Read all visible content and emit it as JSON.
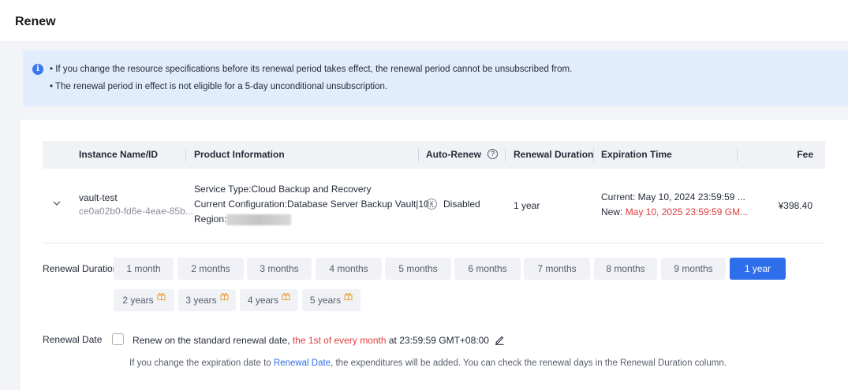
{
  "page": {
    "title": "Renew"
  },
  "notice": {
    "lines": [
      "If you change the resource specifications before its renewal period takes effect, the renewal period cannot be unsubscribed from.",
      "The renewal period in effect is not eligible for a 5-day unconditional unsubscription."
    ]
  },
  "table": {
    "headers": {
      "instance": "Instance Name/ID",
      "product": "Product Information",
      "auto_renew": "Auto-Renew",
      "duration": "Renewal Duration",
      "expiration": "Expiration Time",
      "fee": "Fee"
    },
    "row": {
      "name": "vault-test",
      "id": "ce0a02b0-fd6e-4eae-85b...",
      "service_type": "Service Type:Cloud Backup and Recovery",
      "configuration": "Current Configuration:Database Server Backup Vault|10...",
      "region_label": "Region:",
      "auto_renew": "Disabled",
      "duration": "1 year",
      "current_label": "Current: May 10, 2024 23:59:59 ...",
      "new_label": "New: ",
      "new_date": "May 10, 2025 23:59:59 GM...",
      "fee": "¥398.40"
    }
  },
  "renewal_duration": {
    "label": "Renewal Duration",
    "options": [
      "1 month",
      "2 months",
      "3 months",
      "4 months",
      "5 months",
      "6 months",
      "7 months",
      "8 months",
      "9 months",
      "1 year"
    ],
    "year_options": [
      "2 years",
      "3 years",
      "4 years",
      "5 years"
    ],
    "selected": "1 year"
  },
  "renewal_date": {
    "label": "Renewal Date",
    "checked": false,
    "text_before": "Renew on the standard renewal date, ",
    "highlight": "the 1st of every month",
    "text_after": " at 23:59:59 GMT+08:00",
    "hint_before": "If you change the expiration date to ",
    "hint_link": "Renewal Date",
    "hint_after": ", the expenditures will be added. You can check the renewal days in the Renewal Duration column."
  },
  "colors": {
    "primary": "#2f6eeb",
    "accent_red": "#e03c3c",
    "notice_bg": "#e1ecfc",
    "info_icon": "#3a78ee"
  },
  "icons": [
    "info-icon",
    "help-icon",
    "chevron-down-icon",
    "shield-icon",
    "gift-icon",
    "pencil-icon"
  ]
}
